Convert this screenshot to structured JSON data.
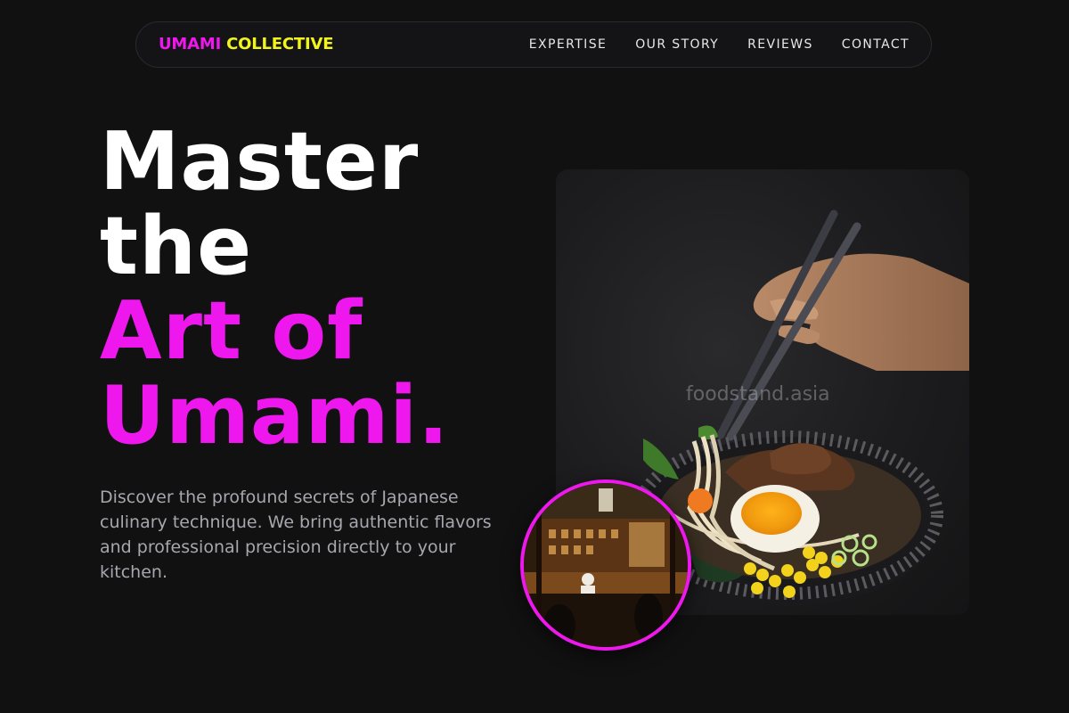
{
  "brand": {
    "part1": "UMAMI",
    "part2": "COLLECTIVE",
    "accent_magenta": "#ee18ee",
    "accent_yellow": "#f2f41e"
  },
  "nav": {
    "items": [
      {
        "label": "EXPERTISE"
      },
      {
        "label": "OUR STORY"
      },
      {
        "label": "REVIEWS"
      },
      {
        "label": "CONTACT"
      }
    ]
  },
  "hero": {
    "headline_line1": "Master",
    "headline_line2": "the",
    "headline_line3": "Art of",
    "headline_line4": "Umami.",
    "description": "Discover the profound secrets of Japanese culinary technique. We bring authentic flavors and professional precision directly to your kitchen.",
    "image_watermark": "foodstand.asia"
  },
  "colors": {
    "background": "#111112",
    "text_primary": "#ffffff",
    "text_secondary": "#a7a7ad"
  }
}
